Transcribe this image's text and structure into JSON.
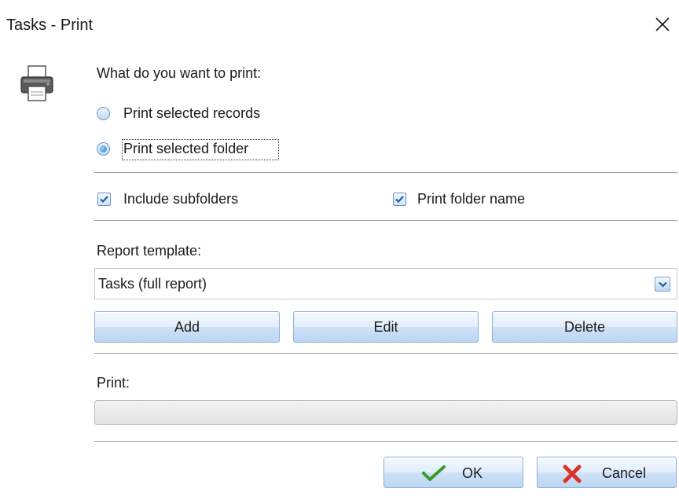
{
  "window": {
    "title": "Tasks - Print",
    "close_icon": "close-icon"
  },
  "print_target": {
    "prompt": "What do you want to print:",
    "options": [
      {
        "label": "Print selected records",
        "checked": false
      },
      {
        "label": "Print selected folder",
        "checked": true
      }
    ]
  },
  "options": {
    "include_subfolders": {
      "label": "Include subfolders",
      "checked": true
    },
    "print_folder_name": {
      "label": "Print folder name",
      "checked": true
    }
  },
  "report": {
    "label": "Report template:",
    "selected": "Tasks (full report)",
    "buttons": {
      "add": "Add",
      "edit": "Edit",
      "delete": "Delete"
    }
  },
  "progress": {
    "label": "Print:",
    "value": 0
  },
  "dialog_buttons": {
    "ok": "OK",
    "cancel": "Cancel"
  },
  "icons": {
    "app": "printer-icon",
    "ok": "checkmark-icon",
    "cancel": "red-x-icon",
    "dropdown": "chevron-down-icon"
  },
  "colors": {
    "accent": "#2e7fd6",
    "button_border": "#8fb0d6",
    "ok_check": "#3a9a2a",
    "cancel_x": "#d8322b"
  }
}
